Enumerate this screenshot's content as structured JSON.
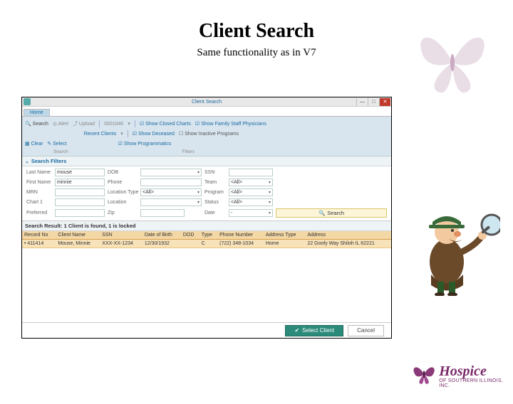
{
  "page": {
    "title": "Client Search",
    "subtitle": "Same functionality as in V7"
  },
  "window": {
    "title": "Client Search",
    "tab": "Home"
  },
  "toolbar": {
    "search": "Search",
    "alert": "Alert",
    "upload": "Upload",
    "id": "0001040",
    "show_closed": "Show Closed Charts",
    "show_family": "Show Family Staff Physicians",
    "recent": "Recent Clients",
    "show_deceased": "Show Deceased",
    "show_inactive": "Show Inactive Programs",
    "clear": "Clear",
    "select": "Select",
    "show_programmatics": "Show Programmatics",
    "group_search": "Search",
    "group_filters": "Filters"
  },
  "filters": {
    "header": "Search Filters",
    "labels": {
      "last_name": "Last Name",
      "first_name": "First Name",
      "mrn": "MRN",
      "chart1": "Chart 1",
      "preferred": "Preferred",
      "dob": "DOB",
      "phone": "Phone",
      "location_type": "Location Type",
      "location": "Location",
      "zip": "Zip",
      "ssn": "SSN",
      "team": "Team",
      "program": "Program",
      "status": "Status",
      "date": "Date"
    },
    "values": {
      "last_name": "mouse",
      "first_name": "minnie",
      "location_type": "<All>",
      "team": "<All>",
      "program": "<All>",
      "status": "<All>",
      "date": "-"
    },
    "search_btn": "Search"
  },
  "results": {
    "header": "Search Result: 1 Client is found, 1 is locked",
    "columns": [
      "Record No",
      "Client Name",
      "SSN",
      "Date of Birth",
      "DOD",
      "Type",
      "Phone Number",
      "Address Type",
      "Address"
    ],
    "rows": [
      {
        "record_no": "411414",
        "client_name": "Mouse, Minnie",
        "ssn": "XXX-XX-1234",
        "dob": "12/30/1932",
        "dod": "",
        "type": "C",
        "phone": "(722) 348-1034",
        "address_type": "Home",
        "address": "22 Goofy Way Shiloh IL 62221"
      }
    ]
  },
  "footer": {
    "select": "Select Client",
    "cancel": "Cancel"
  },
  "logo": {
    "line1": "Hospice",
    "line2": "OF SOUTHERN ILLINOIS, INC."
  }
}
